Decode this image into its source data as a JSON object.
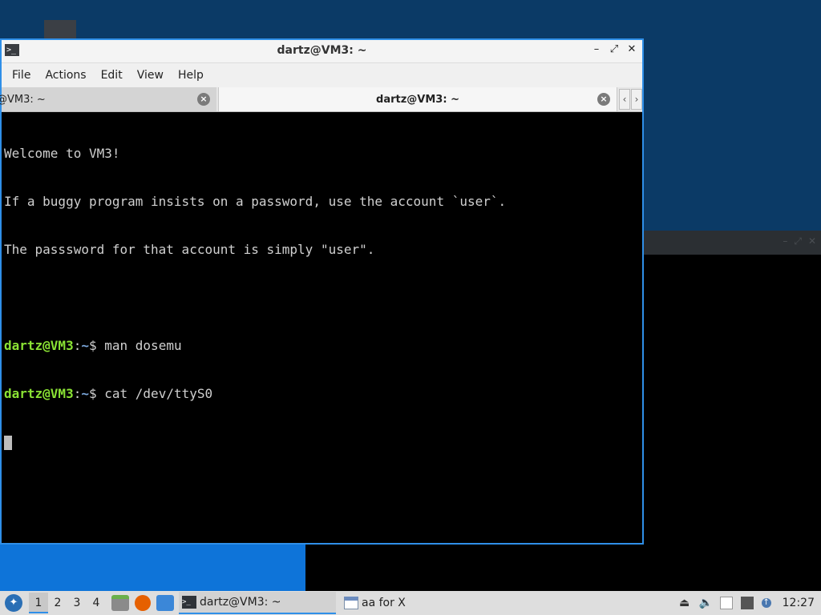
{
  "terminal": {
    "window_title": "dartz@VM3: ~",
    "menu": [
      "File",
      "Actions",
      "Edit",
      "View",
      "Help"
    ],
    "tabs": [
      {
        "label": "@VM3: ~",
        "active": false
      },
      {
        "label": "dartz@VM3: ~",
        "active": true
      }
    ],
    "output_lines": [
      "Welcome to VM3!",
      "If a buggy program insists on a password, use the account `user`.",
      "The passsword for that account is simply \"user\"."
    ],
    "commands": [
      {
        "user": "dartz@VM3",
        "path": "~",
        "symbol": "$",
        "command": " man dosemu"
      },
      {
        "user": "dartz@VM3",
        "path": "~",
        "symbol": "$",
        "command": " cat /dev/ttyS0"
      }
    ],
    "controls": {
      "minimize": "–",
      "maximize": "⤢",
      "close": "✕"
    },
    "tab_close": "×",
    "tab_scroll_left": "‹",
    "tab_scroll_right": "›"
  },
  "taskbar": {
    "workspaces": [
      "1",
      "2",
      "3",
      "4"
    ],
    "active_workspace": "1",
    "tasks": [
      {
        "label": "dartz@VM3: ~",
        "icon": "terminal-icon",
        "active": true
      },
      {
        "label": "aa for X",
        "icon": "window-icon",
        "active": false
      }
    ],
    "clock": "12:27",
    "tray_icons": [
      "eject-icon",
      "volume-icon",
      "clipboard-icon",
      "network-icon",
      "update-icon"
    ]
  },
  "colors": {
    "desktop": "#0b3a66",
    "accent": "#2f8fe8",
    "prompt_user": "#8ae234",
    "prompt_path": "#7aa6da"
  }
}
